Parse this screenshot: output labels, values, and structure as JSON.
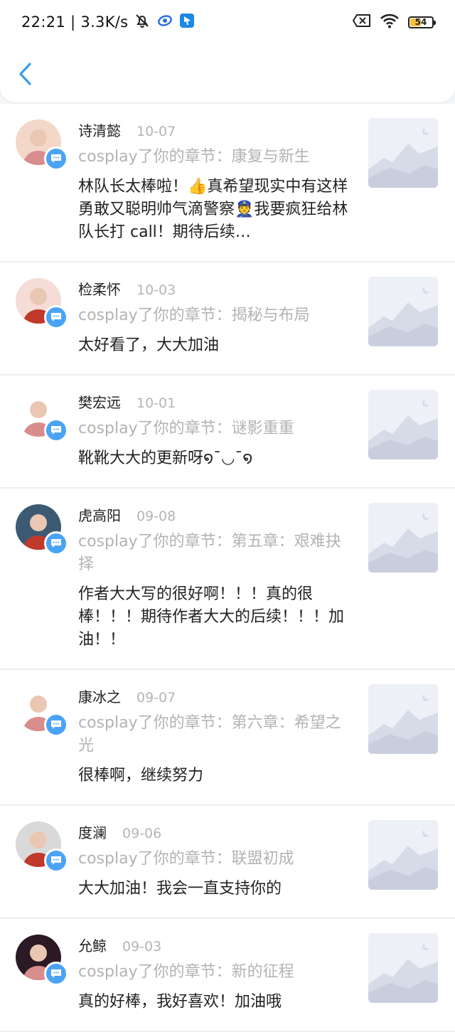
{
  "status_bar": {
    "time": "22:21",
    "network_speed": "3.3K/s",
    "battery_level": "54",
    "colors": {
      "battery_fill": "#f5c23a",
      "app_icon_1": "#2f6fe4",
      "app_icon_2": "#1e88e5"
    },
    "icons": [
      "mute-bell-icon",
      "browser-app-icon",
      "messenger-app-icon",
      "sim-disabled-icon",
      "wifi-icon",
      "battery-icon"
    ]
  },
  "nav": {
    "back_icon": "chevron-left-icon",
    "accent": "#3a9ee8"
  },
  "comments": [
    {
      "name": "诗清懿",
      "date": "10-07",
      "chapter": "cosplay了你的章节：康复与新生",
      "text": "林队长太棒啦！👍真希望现实中有这样勇敢又聪明帅气滴警察👮我要疯狂给林队长打 call！期待后续…",
      "avatar_color": "#f3d7c9"
    },
    {
      "name": "检柔怀",
      "date": "10-03",
      "chapter": "cosplay了你的章节：揭秘与布局",
      "text": "太好看了，大大加油",
      "avatar_color": "#f6dcd6"
    },
    {
      "name": "樊宏远",
      "date": "10-01",
      "chapter": "cosplay了你的章节：谜影重重",
      "text": "靴靴大大的更新呀໑¯◡¯໑",
      "avatar_color": "#ffffff"
    },
    {
      "name": "虎高阳",
      "date": "09-08",
      "chapter": "cosplay了你的章节：第五章：艰难抉择",
      "text": "作者大大写的很好啊！！！真的很棒！！！期待作者大大的后续！！！加油！！",
      "avatar_color": "#3d5a73"
    },
    {
      "name": "康冰之",
      "date": "09-07",
      "chapter": "cosplay了你的章节：第六章：希望之光",
      "text": "很棒啊，继续努力",
      "avatar_color": "#ffffff"
    },
    {
      "name": "度澜",
      "date": "09-06",
      "chapter": "cosplay了你的章节：联盟初成",
      "text": "大大加油！我会一直支持你的",
      "avatar_color": "#d9d9d9"
    },
    {
      "name": "允鲸",
      "date": "09-03",
      "chapter": "cosplay了你的章节：新的征程",
      "text": "真的好棒，我好喜欢！加油哦",
      "avatar_color": "#2b1a24"
    }
  ],
  "comment_badge_color": "#4aa3f5",
  "thumbnail_icon": "image-placeholder-icon"
}
